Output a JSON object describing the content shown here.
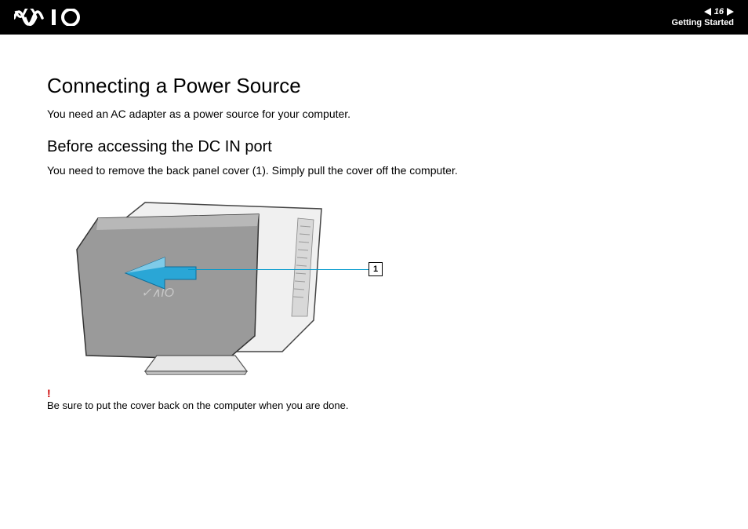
{
  "header": {
    "page_number": "16",
    "section": "Getting Started"
  },
  "content": {
    "h1": "Connecting a Power Source",
    "intro": "You need an AC adapter as a power source for your computer.",
    "h2": "Before accessing the DC IN port",
    "sub_intro": "You need to remove the back panel cover (1). Simply pull the cover off the computer.",
    "callout_label": "1",
    "note_symbol": "!",
    "note_text": "Be sure to put the cover back on the computer when you are done."
  }
}
